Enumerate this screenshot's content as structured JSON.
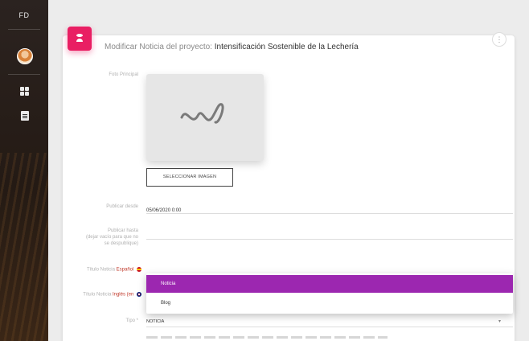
{
  "sidebar": {
    "brand": "FD",
    "avatar_icon": "user-avatar",
    "items": [
      {
        "icon": "dashboard-icon"
      },
      {
        "icon": "document-icon"
      }
    ]
  },
  "header": {
    "title_prefix": "Modificar Noticia del proyecto:",
    "project_name": "Intensificación Sostenible de la Lechería",
    "badge_icon": "person-icon",
    "badge_color": "#e91e63",
    "more_label": "⋮"
  },
  "form": {
    "foto_label": "Foto Principal",
    "select_image_button": "SELECCIONAR IMAGEN",
    "publicar_desde_label": "Publicar desde",
    "publicar_desde_value": "05/06/2020 0:00",
    "publicar_hasta_label_1": "Publicar hasta",
    "publicar_hasta_label_2": "(dejar vacío para que no",
    "publicar_hasta_label_3": "se despublique)",
    "titulo_es_label_a": "Título Noticia",
    "titulo_es_label_b": "Español",
    "titulo_en_label_a": "Título Noticia",
    "titulo_en_label_b": "Inglés (en",
    "tipo_label": "Tipo *",
    "tipo_value": "NOTICIA",
    "tipo_caret": "▾"
  },
  "dropdown": {
    "options": [
      "Noticia",
      "Blog"
    ],
    "active_color": "#9c27b0"
  }
}
